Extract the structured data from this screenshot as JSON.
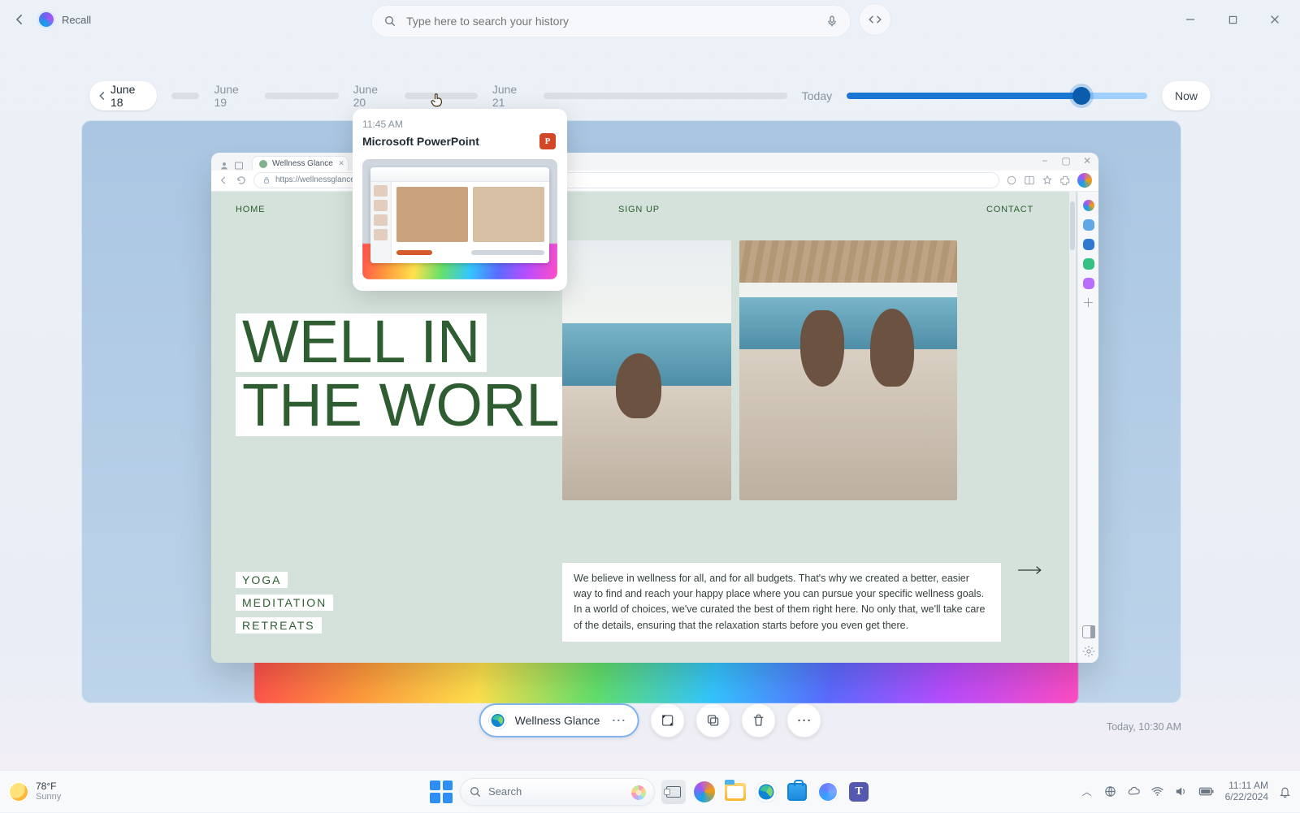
{
  "app": {
    "name": "Recall",
    "search_placeholder": "Type here to search your history"
  },
  "timeline": {
    "dates": [
      "June 18",
      "June 19",
      "June 20",
      "June 21"
    ],
    "today_label": "Today",
    "now_label": "Now"
  },
  "hover_preview": {
    "time": "11:45 AM",
    "app": "Microsoft PowerPoint",
    "icon_letter": "P"
  },
  "snapshot": {
    "browser_tab_title": "Wellness Glance",
    "browser_url": "https://wellnessglance.com",
    "site": {
      "nav": {
        "home": "HOME",
        "sign_up": "SIGN UP",
        "contact": "CONTACT"
      },
      "headline_line1": "WELL IN",
      "headline_line2": "THE WORLD",
      "tags": [
        "YOGA",
        "MEDITATION",
        "RETREATS"
      ],
      "body_copy": "We believe in wellness for all, and for all budgets. That's why we created a better, easier way to find and reach your happy place where you can pursue your specific wellness goals. In a world of choices, we've curated the best of them right here. No only that, we'll take care of the details, ensuring that the relaxation starts before you even get there."
    }
  },
  "actions": {
    "open_in_label": "Wellness Glance"
  },
  "snapshot_timestamp": "Today, 10:30 AM",
  "taskbar": {
    "weather_temp": "78°F",
    "weather_cond": "Sunny",
    "search_placeholder": "Search",
    "clock_time": "11:11 AM",
    "clock_date": "6/22/2024"
  }
}
